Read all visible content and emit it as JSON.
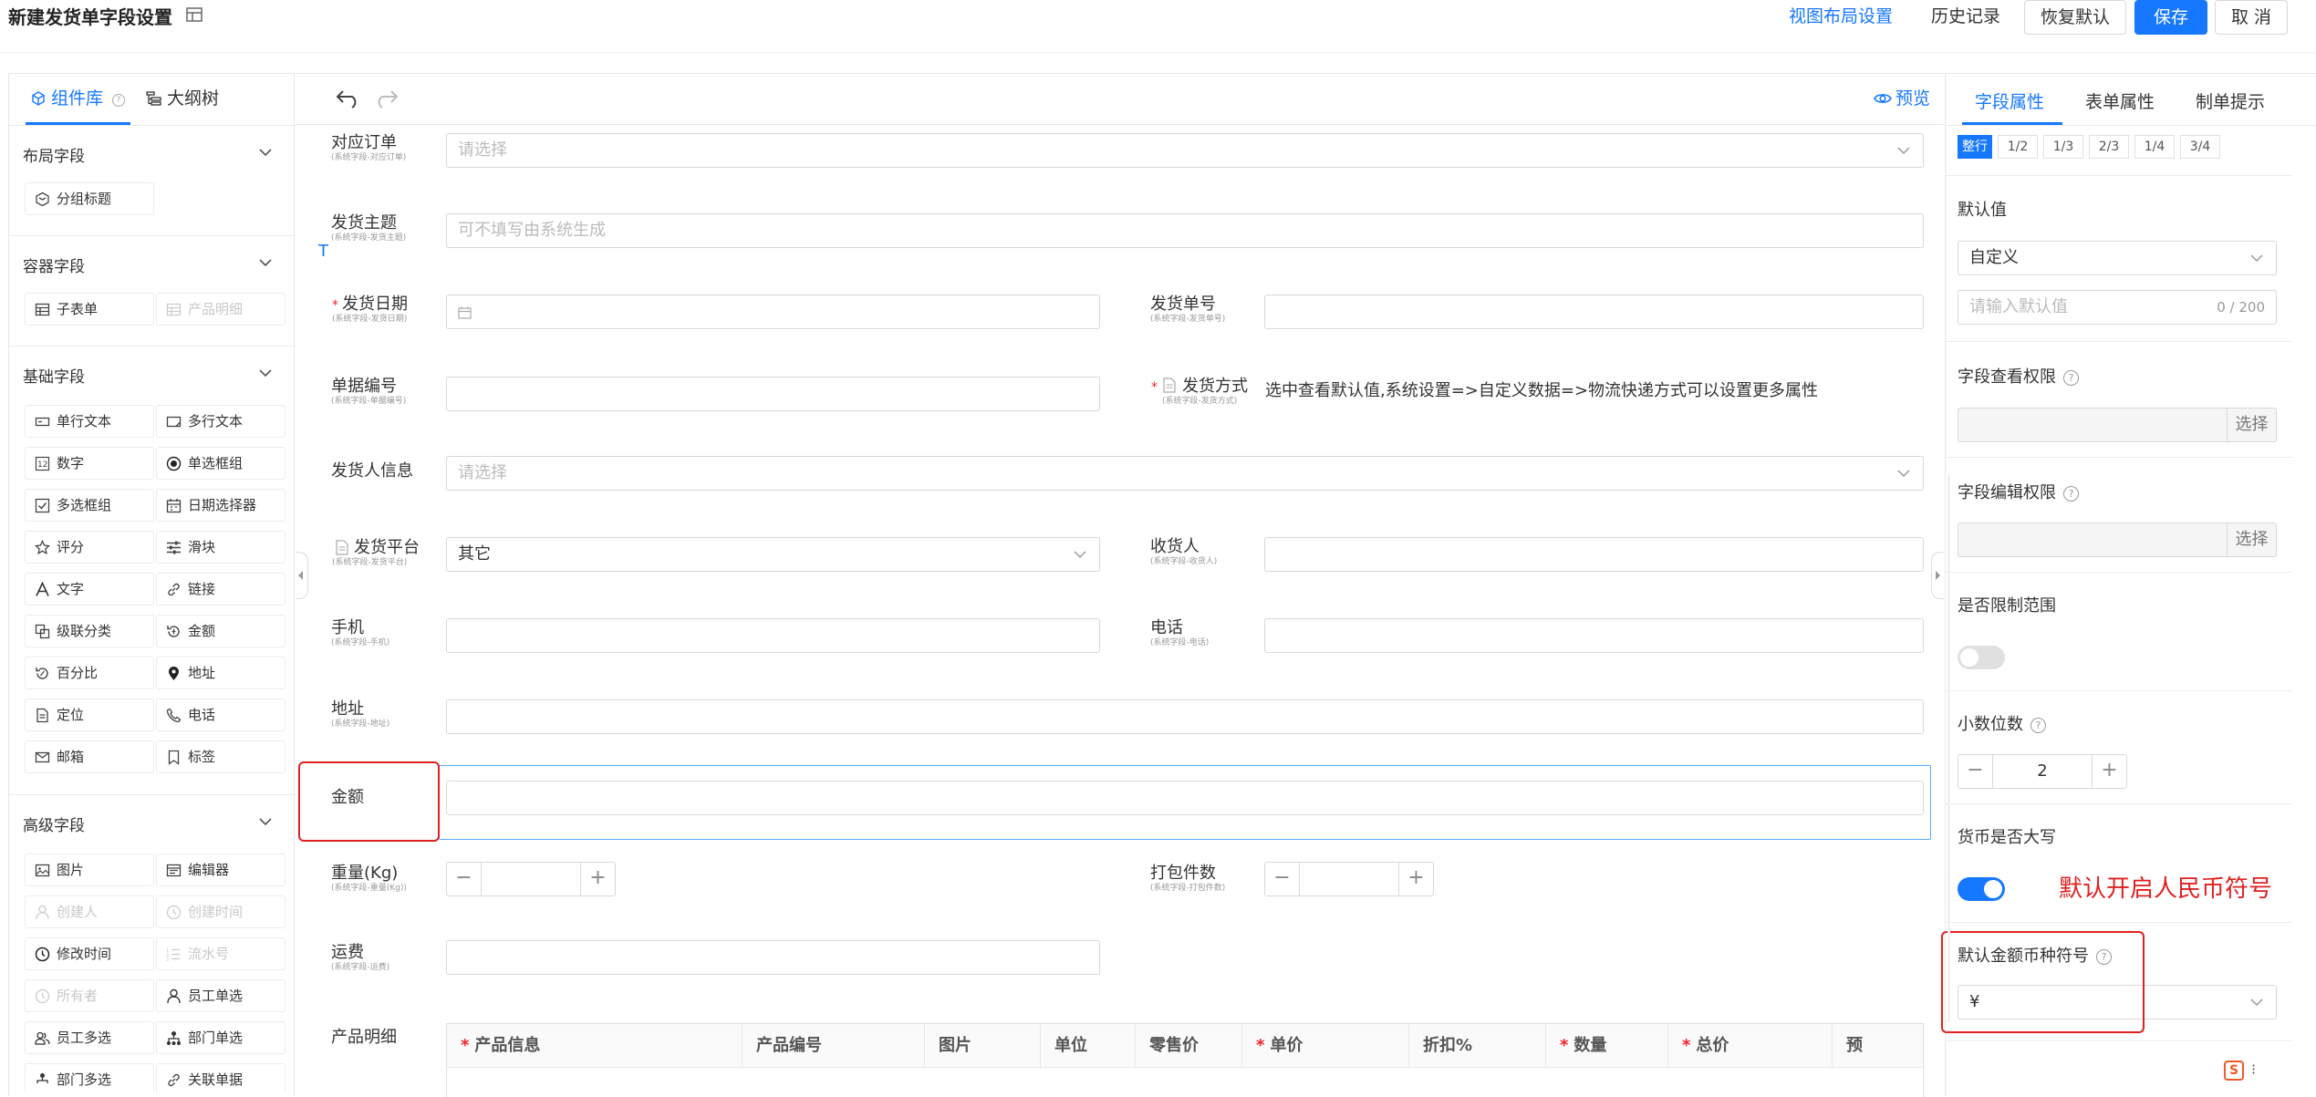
{
  "header": {
    "title": "新建发货单字段设置",
    "view_layout": "视图布局设置",
    "history": "历史记录",
    "restore_default": "恢复默认",
    "save": "保存",
    "cancel": "取 消"
  },
  "left_panel": {
    "tabs": [
      {
        "label": "组件库"
      },
      {
        "label": "大纲树"
      }
    ],
    "sections": [
      {
        "title": "布局字段",
        "items": [
          {
            "label": "分组标题",
            "icon": "group-title-icon",
            "disabled": false
          }
        ]
      },
      {
        "title": "容器字段",
        "items": [
          {
            "label": "子表单",
            "icon": "table-icon",
            "disabled": false
          },
          {
            "label": "产品明细",
            "icon": "table-icon",
            "disabled": true
          }
        ]
      },
      {
        "title": "基础字段",
        "items": [
          {
            "label": "单行文本",
            "icon": "single-line-icon",
            "disabled": false
          },
          {
            "label": "多行文本",
            "icon": "multi-line-icon",
            "disabled": false
          },
          {
            "label": "数字",
            "icon": "number-icon",
            "disabled": false
          },
          {
            "label": "单选框组",
            "icon": "radio-icon",
            "disabled": false
          },
          {
            "label": "多选框组",
            "icon": "checkbox-icon",
            "disabled": false
          },
          {
            "label": "日期选择器",
            "icon": "calendar-icon",
            "disabled": false
          },
          {
            "label": "评分",
            "icon": "star-icon",
            "disabled": false
          },
          {
            "label": "滑块",
            "icon": "slider-icon",
            "disabled": false
          },
          {
            "label": "文字",
            "icon": "text-icon",
            "disabled": false
          },
          {
            "label": "链接",
            "icon": "link-icon",
            "disabled": false
          },
          {
            "label": "级联分类",
            "icon": "cascade-icon",
            "disabled": false
          },
          {
            "label": "金额",
            "icon": "amount-icon",
            "disabled": false
          },
          {
            "label": "百分比",
            "icon": "percent-icon",
            "disabled": false
          },
          {
            "label": "地址",
            "icon": "location-pin-icon",
            "disabled": false
          },
          {
            "label": "定位",
            "icon": "locate-icon",
            "disabled": false
          },
          {
            "label": "电话",
            "icon": "phone-icon",
            "disabled": false
          },
          {
            "label": "邮箱",
            "icon": "mail-icon",
            "disabled": false
          },
          {
            "label": "标签",
            "icon": "tag-icon",
            "disabled": false
          }
        ]
      },
      {
        "title": "高级字段",
        "items": [
          {
            "label": "图片",
            "icon": "image-icon",
            "disabled": false
          },
          {
            "label": "编辑器",
            "icon": "editor-icon",
            "disabled": false
          },
          {
            "label": "创建人",
            "icon": "user-icon",
            "disabled": true
          },
          {
            "label": "创建时间",
            "icon": "clock-icon",
            "disabled": true
          },
          {
            "label": "修改时间",
            "icon": "clock-icon",
            "disabled": false
          },
          {
            "label": "流水号",
            "icon": "serial-icon",
            "disabled": true
          },
          {
            "label": "所有者",
            "icon": "owner-icon",
            "disabled": true
          },
          {
            "label": "员工单选",
            "icon": "user-icon",
            "disabled": false
          },
          {
            "label": "员工多选",
            "icon": "users-icon",
            "disabled": false
          },
          {
            "label": "部门单选",
            "icon": "org-icon",
            "disabled": false
          },
          {
            "label": "部门多选",
            "icon": "org-icon",
            "disabled": false
          },
          {
            "label": "关联单据",
            "icon": "link-icon",
            "disabled": false
          }
        ]
      }
    ]
  },
  "canvas": {
    "preview": "预览",
    "cursor_mark": "T",
    "fields": {
      "order": {
        "label": "对应订单",
        "sub": "(系统字段-对应订单)",
        "placeholder": "请选择"
      },
      "subject": {
        "label": "发货主题",
        "sub": "(系统字段-发货主题)",
        "placeholder": "可不填写由系统生成"
      },
      "ship_date": {
        "label": "发货日期",
        "sub": "(系统字段-发货日期)"
      },
      "ship_no": {
        "label": "发货单号",
        "sub": "(系统字段-发货单号)"
      },
      "doc_no": {
        "label": "单据编号",
        "sub": "(系统字段-单据编号)"
      },
      "ship_method": {
        "label": "发货方式",
        "sub": "(系统字段-发货方式)",
        "note": "选中查看默认值,系统设置=>自定义数据=>物流快递方式可以设置更多属性"
      },
      "sender": {
        "label": "发货人信息",
        "placeholder": "请选择"
      },
      "platform": {
        "label": "发货平台",
        "sub": "(系统字段-发货平台)",
        "value": "其它"
      },
      "receiver": {
        "label": "收货人",
        "sub": "(系统字段-收货人)"
      },
      "mobile": {
        "label": "手机",
        "sub": "(系统字段-手机)"
      },
      "tel": {
        "label": "电话",
        "sub": "(系统字段-电话)"
      },
      "address": {
        "label": "地址",
        "sub": "(系统字段-地址)"
      },
      "amount": {
        "label": "金额"
      },
      "weight": {
        "label": "重量(Kg)",
        "sub": "(系统字段-重量(Kg))"
      },
      "packages": {
        "label": "打包件数",
        "sub": "(系统字段-打包件数)"
      },
      "freight": {
        "label": "运费",
        "sub": "(系统字段-运费)"
      },
      "products": {
        "label": "产品明细"
      }
    },
    "product_table": {
      "columns": [
        {
          "label": "产品信息",
          "required": true
        },
        {
          "label": "产品编号",
          "required": false
        },
        {
          "label": "图片",
          "required": false
        },
        {
          "label": "单位",
          "required": false
        },
        {
          "label": "零售价",
          "required": false
        },
        {
          "label": "单价",
          "required": true
        },
        {
          "label": "折扣%",
          "required": false
        },
        {
          "label": "数量",
          "required": true
        },
        {
          "label": "总价",
          "required": true
        },
        {
          "label": "预",
          "required": false
        }
      ]
    }
  },
  "right_panel": {
    "tabs": [
      "字段属性",
      "表单属性",
      "制单提示"
    ],
    "width_options": [
      "整行",
      "1/2",
      "1/3",
      "2/3",
      "1/4",
      "3/4"
    ],
    "default_value": {
      "label": "默认值",
      "type": "自定义",
      "placeholder": "请输入默认值",
      "counter": "0 / 200"
    },
    "view_permission": {
      "label": "字段查看权限",
      "button": "选择"
    },
    "edit_permission": {
      "label": "字段编辑权限",
      "button": "选择"
    },
    "limit_range": {
      "label": "是否限制范围",
      "enabled": false
    },
    "decimals": {
      "label": "小数位数",
      "value": "2"
    },
    "uppercase": {
      "label": "货币是否大写",
      "enabled": true
    },
    "annotation": "默认开启人民币符号",
    "currency_symbol": {
      "label": "默认金额币种符号",
      "value": "¥"
    }
  },
  "colors": {
    "accent": "#1677ff",
    "annotation": "#e02020"
  }
}
